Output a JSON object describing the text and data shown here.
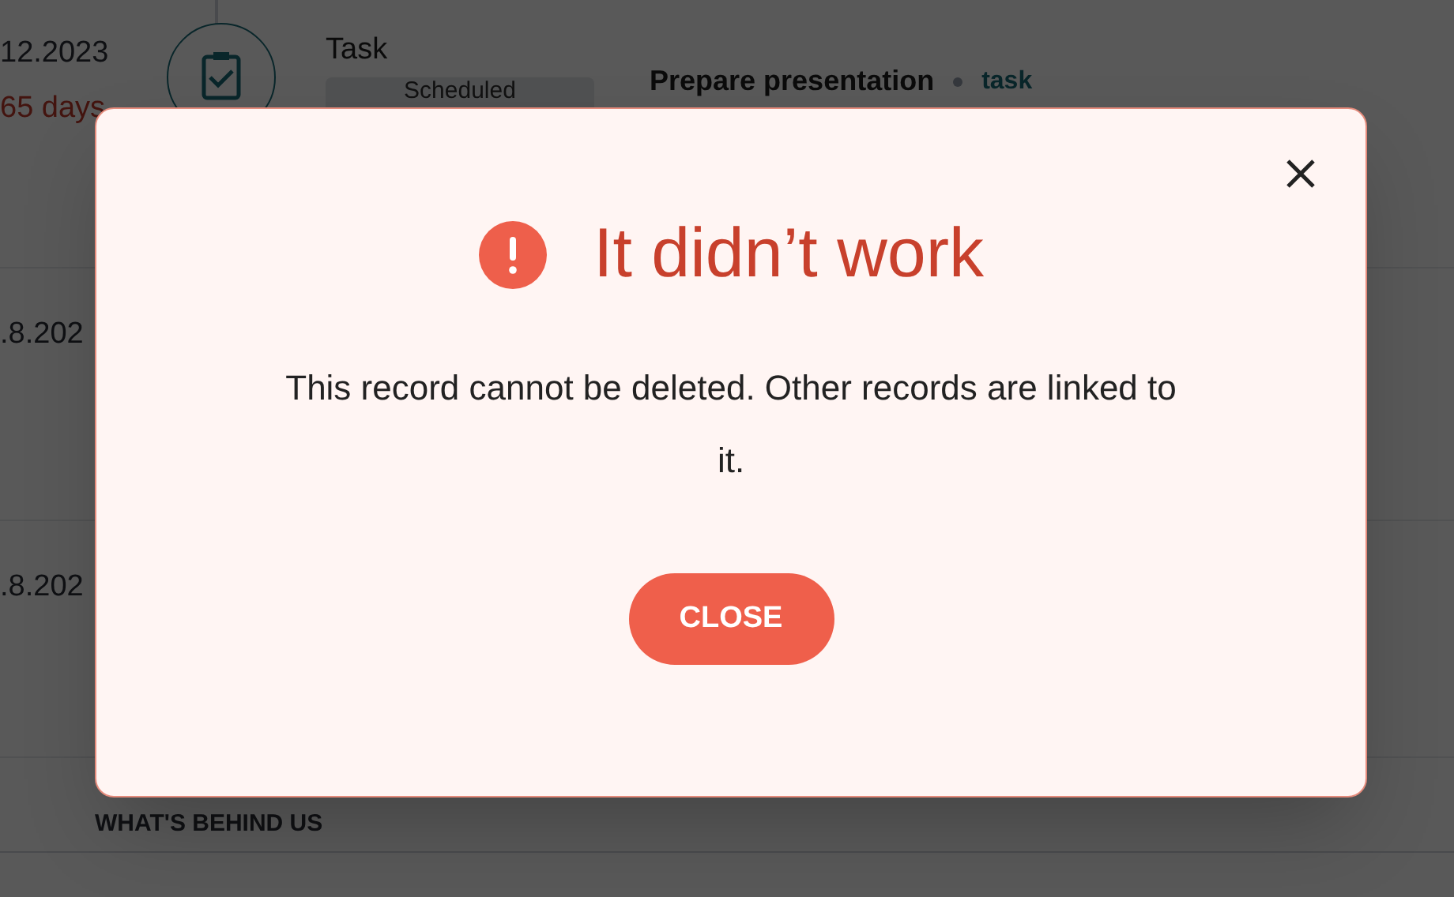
{
  "background_page": {
    "rows": [
      {
        "date": "12.2023",
        "due": "65 days",
        "kind_label": "Task",
        "status": "Scheduled",
        "title": "Prepare presentation",
        "tag": "task"
      },
      {
        "date": ".8.202"
      },
      {
        "date": ".8.202"
      }
    ],
    "section_heading": "WHAT'S BEHIND US"
  },
  "dialog": {
    "title": "It didn’t work",
    "message": "This record cannot be deleted. Other records are linked to it.",
    "button": "CLOSE"
  }
}
